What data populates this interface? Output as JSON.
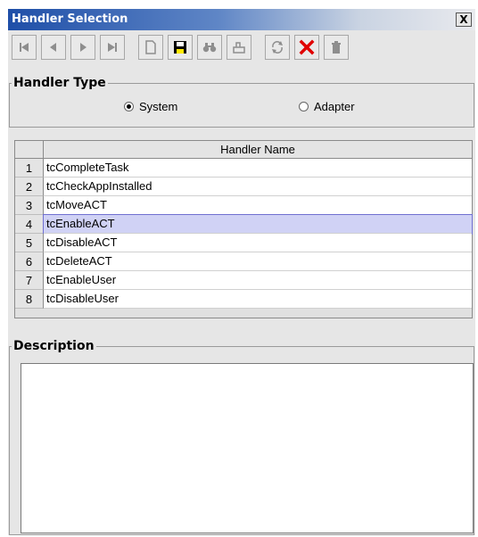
{
  "window": {
    "title": "Handler Selection",
    "close_label": "X"
  },
  "toolbar": {
    "buttons": [
      {
        "name": "first-record",
        "icon": "skip-back-icon",
        "enabled": false
      },
      {
        "name": "previous-record",
        "icon": "arrow-left-icon",
        "enabled": false
      },
      {
        "name": "next-record",
        "icon": "arrow-right-icon",
        "enabled": false
      },
      {
        "name": "last-record",
        "icon": "skip-forward-icon",
        "enabled": false
      },
      {
        "name": "new-record",
        "icon": "new-document-icon",
        "enabled": false
      },
      {
        "name": "save",
        "icon": "floppy-disk-icon",
        "enabled": true
      },
      {
        "name": "find",
        "icon": "binoculars-icon",
        "enabled": false
      },
      {
        "name": "query",
        "icon": "query-icon",
        "enabled": false
      },
      {
        "name": "refresh",
        "icon": "refresh-icon",
        "enabled": false
      },
      {
        "name": "cancel",
        "icon": "red-x-icon",
        "enabled": true
      },
      {
        "name": "delete",
        "icon": "trash-icon",
        "enabled": false
      }
    ]
  },
  "handler_type": {
    "legend": "Handler Type",
    "options": [
      {
        "label": "System",
        "selected": true
      },
      {
        "label": "Adapter",
        "selected": false
      }
    ]
  },
  "table": {
    "column_header": "Handler Name",
    "selected_row": 4,
    "rows": [
      {
        "num": "1",
        "name": "tcCompleteTask"
      },
      {
        "num": "2",
        "name": "tcCheckAppInstalled"
      },
      {
        "num": "3",
        "name": "tcMoveACT"
      },
      {
        "num": "4",
        "name": "tcEnableACT"
      },
      {
        "num": "5",
        "name": "tcDisableACT"
      },
      {
        "num": "6",
        "name": "tcDeleteACT"
      },
      {
        "num": "7",
        "name": "tcEnableUser"
      },
      {
        "num": "8",
        "name": "tcDisableUser"
      }
    ]
  },
  "description": {
    "legend": "Description",
    "value": ""
  },
  "colors": {
    "selection": "#d0d2f5",
    "title_start": "#1f4fa8",
    "cancel_red": "#e00000"
  }
}
